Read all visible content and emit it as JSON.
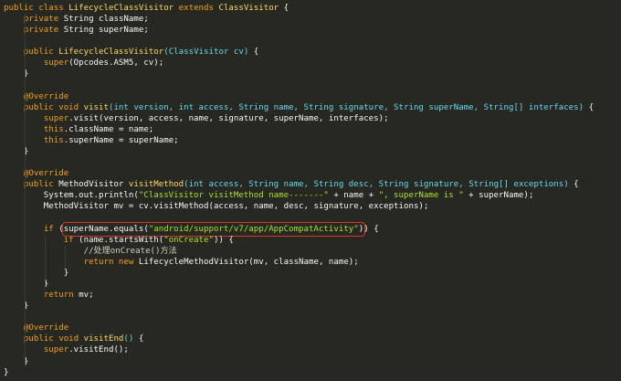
{
  "colors": {
    "background": "#272822",
    "keyword": "#f0a020",
    "class_name": "#ffd866",
    "param": "#66d9ef",
    "string": "#a6e22e",
    "plain": "#f8f8f2",
    "highlight_box": "#d9342b"
  },
  "code": {
    "lines": [
      {
        "tokens": [
          {
            "t": "keyword",
            "v": "public class "
          },
          {
            "t": "class",
            "v": "LifecycleClassVisitor"
          },
          {
            "t": "keyword",
            "v": " extends "
          },
          {
            "t": "class",
            "v": "ClassVisitor"
          },
          {
            "t": "plain",
            "v": " {"
          }
        ]
      },
      {
        "tokens": [
          {
            "t": "plain",
            "v": "    "
          },
          {
            "t": "keyword",
            "v": "private "
          },
          {
            "t": "plain",
            "v": "String className;"
          }
        ]
      },
      {
        "tokens": [
          {
            "t": "plain",
            "v": "    "
          },
          {
            "t": "keyword",
            "v": "private "
          },
          {
            "t": "plain",
            "v": "String superName;"
          }
        ]
      },
      {
        "tokens": []
      },
      {
        "tokens": [
          {
            "t": "plain",
            "v": "    "
          },
          {
            "t": "keyword",
            "v": "public "
          },
          {
            "t": "func",
            "v": "LifecycleClassVisitor"
          },
          {
            "t": "param",
            "v": "(ClassVisitor cv)"
          },
          {
            "t": "plain",
            "v": " {"
          }
        ]
      },
      {
        "tokens": [
          {
            "t": "plain",
            "v": "        "
          },
          {
            "t": "keyword",
            "v": "super"
          },
          {
            "t": "plain",
            "v": "(Opcodes.ASM5, cv);"
          }
        ]
      },
      {
        "tokens": [
          {
            "t": "plain",
            "v": "    }"
          }
        ]
      },
      {
        "tokens": []
      },
      {
        "tokens": [
          {
            "t": "plain",
            "v": "    "
          },
          {
            "t": "annotation",
            "v": "@Override"
          }
        ]
      },
      {
        "tokens": [
          {
            "t": "plain",
            "v": "    "
          },
          {
            "t": "keyword",
            "v": "public void "
          },
          {
            "t": "func",
            "v": "visit"
          },
          {
            "t": "param",
            "v": "(int version, int access, String name, String signature, String superName, String[] interfaces)"
          },
          {
            "t": "plain",
            "v": " {"
          }
        ]
      },
      {
        "tokens": [
          {
            "t": "plain",
            "v": "        "
          },
          {
            "t": "keyword",
            "v": "super"
          },
          {
            "t": "plain",
            "v": ".visit(version, access, name, signature, superName, interfaces);"
          }
        ]
      },
      {
        "tokens": [
          {
            "t": "plain",
            "v": "        "
          },
          {
            "t": "keyword",
            "v": "this"
          },
          {
            "t": "plain",
            "v": ".className = name;"
          }
        ]
      },
      {
        "tokens": [
          {
            "t": "plain",
            "v": "        "
          },
          {
            "t": "keyword",
            "v": "this"
          },
          {
            "t": "plain",
            "v": ".superName = superName;"
          }
        ]
      },
      {
        "tokens": [
          {
            "t": "plain",
            "v": "    }"
          }
        ]
      },
      {
        "tokens": []
      },
      {
        "tokens": [
          {
            "t": "plain",
            "v": "    "
          },
          {
            "t": "annotation",
            "v": "@Override"
          }
        ]
      },
      {
        "tokens": [
          {
            "t": "plain",
            "v": "    "
          },
          {
            "t": "keyword",
            "v": "public "
          },
          {
            "t": "plain",
            "v": "MethodVisitor "
          },
          {
            "t": "func",
            "v": "visitMethod"
          },
          {
            "t": "param",
            "v": "(int access, String name, String desc, String signature, String[] exceptions)"
          },
          {
            "t": "plain",
            "v": " {"
          }
        ]
      },
      {
        "tokens": [
          {
            "t": "plain",
            "v": "        System.out.println("
          },
          {
            "t": "string",
            "v": "\"ClassVisitor visitMethod name-------\""
          },
          {
            "t": "plain",
            "v": " + name + "
          },
          {
            "t": "string",
            "v": "\", superName is \""
          },
          {
            "t": "plain",
            "v": " + superName);"
          }
        ]
      },
      {
        "tokens": [
          {
            "t": "plain",
            "v": "        MethodVisitor mv = cv.visitMethod(access, name, desc, signature, exceptions);"
          }
        ]
      },
      {
        "tokens": []
      },
      {
        "highlight": true,
        "tokens": [
          {
            "t": "plain",
            "v": "        "
          },
          {
            "t": "keyword",
            "v": "if "
          },
          {
            "t": "plain",
            "v": "("
          },
          {
            "t": "box_start",
            "v": ""
          },
          {
            "t": "plain",
            "v": "superName.equals("
          },
          {
            "t": "string",
            "v": "\"android/support/v7/app/AppCompatActivity\""
          },
          {
            "t": "plain",
            "v": ")"
          },
          {
            "t": "box_end",
            "v": ""
          },
          {
            "t": "plain",
            "v": ") {"
          }
        ]
      },
      {
        "tokens": [
          {
            "t": "plain",
            "v": "            "
          },
          {
            "t": "keyword",
            "v": "if "
          },
          {
            "t": "plain",
            "v": "(name.startsWith("
          },
          {
            "t": "string",
            "v": "\"onCreate\""
          },
          {
            "t": "plain",
            "v": ")) {"
          }
        ]
      },
      {
        "tokens": [
          {
            "t": "plain",
            "v": "                "
          },
          {
            "t": "comment",
            "v": "//处理onCreate()方法"
          }
        ]
      },
      {
        "tokens": [
          {
            "t": "plain",
            "v": "                "
          },
          {
            "t": "keyword",
            "v": "return new "
          },
          {
            "t": "plain",
            "v": "LifecycleMethodVisitor(mv, className, name);"
          }
        ]
      },
      {
        "tokens": [
          {
            "t": "plain",
            "v": "            }"
          }
        ]
      },
      {
        "tokens": [
          {
            "t": "plain",
            "v": "        }"
          }
        ]
      },
      {
        "tokens": [
          {
            "t": "plain",
            "v": "        "
          },
          {
            "t": "keyword",
            "v": "return "
          },
          {
            "t": "plain",
            "v": "mv;"
          }
        ]
      },
      {
        "tokens": [
          {
            "t": "plain",
            "v": "    }"
          }
        ]
      },
      {
        "tokens": []
      },
      {
        "tokens": [
          {
            "t": "plain",
            "v": "    "
          },
          {
            "t": "annotation",
            "v": "@Override"
          }
        ]
      },
      {
        "tokens": [
          {
            "t": "plain",
            "v": "    "
          },
          {
            "t": "keyword",
            "v": "public void "
          },
          {
            "t": "func",
            "v": "visitEnd"
          },
          {
            "t": "param",
            "v": "()"
          },
          {
            "t": "plain",
            "v": " {"
          }
        ]
      },
      {
        "tokens": [
          {
            "t": "plain",
            "v": "        "
          },
          {
            "t": "keyword",
            "v": "super"
          },
          {
            "t": "plain",
            "v": ".visitEnd();"
          }
        ]
      },
      {
        "tokens": [
          {
            "t": "plain",
            "v": "    }"
          }
        ]
      },
      {
        "tokens": [
          {
            "t": "plain",
            "v": "}"
          }
        ]
      }
    ]
  }
}
